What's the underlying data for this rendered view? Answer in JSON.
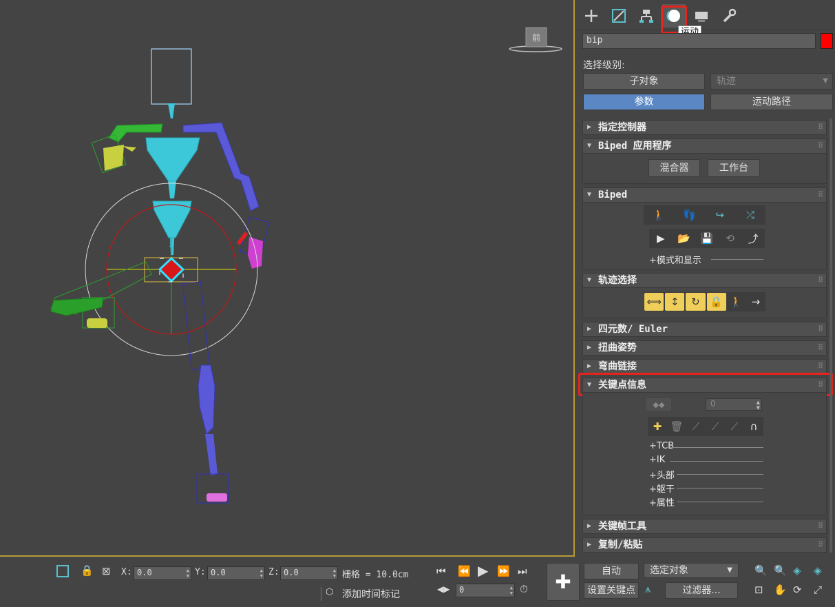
{
  "viewport": {
    "label": "前"
  },
  "command_panel": {
    "tabs": [
      {
        "name": "create",
        "glyph": "+"
      },
      {
        "name": "modify",
        "glyph": "⟋"
      },
      {
        "name": "hierarchy",
        "glyph": "⛶"
      },
      {
        "name": "motion",
        "glyph": "●"
      },
      {
        "name": "display",
        "glyph": "▬"
      },
      {
        "name": "utilities",
        "glyph": "🔧"
      }
    ],
    "tooltip": "运动",
    "object_name": "bip",
    "object_color": "#ff0000",
    "selection_level_label": "选择级别:",
    "sub_object_button": "子对象",
    "track_dropdown": "轨迹",
    "params_button": "参数",
    "motion_paths_button": "运动路径"
  },
  "rollouts": {
    "assign_controller": "指定控制器",
    "biped_apps": {
      "title": "Biped 应用程序",
      "mixer": "混合器",
      "workbench": "工作台"
    },
    "biped": {
      "title": "Biped",
      "mode_display": "+模式和显示"
    },
    "track_selection": "轨迹选择",
    "quaternion": "四元数/ Euler",
    "twist_poses": "扭曲姿势",
    "bend_links": "弯曲链接",
    "key_info": {
      "title": "关键点信息",
      "key_number": "0",
      "subs": [
        "+TCB",
        "+IK",
        "+头部",
        "+躯干",
        "+属性"
      ]
    },
    "keyframing_tools": "关键帧工具",
    "copy_paste": "复制/粘贴"
  },
  "status_bar": {
    "x_label": "X:",
    "x_value": "0.0",
    "y_label": "Y:",
    "y_value": "0.0",
    "z_label": "Z:",
    "z_value": "0.0",
    "grid": "栅格 = 10.0cm",
    "add_time_tag": "添加时间标记",
    "frame": "0",
    "auto_key": "自动",
    "selected_object": "选定对象",
    "set_key": "设置关键点",
    "filters": "过滤器..."
  },
  "colors": {
    "panel_bg": "#444444",
    "active_button": "#5b88c4",
    "highlight": "#e8221c",
    "track_buttons": "#efcf5a",
    "viewport_border": "#b89a3a"
  }
}
